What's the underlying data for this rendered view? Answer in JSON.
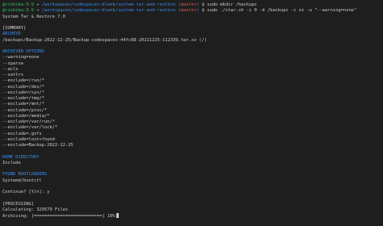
{
  "prompts": [
    {
      "user": "@rishika-3-V",
      "arrow": "→",
      "path": "/workspaces/codespaces-blank/system-tar-and-restore",
      "branch_open": "(",
      "branch": "master",
      "branch_close": ")",
      "command": "$ sudo mkdir /backups"
    },
    {
      "user": "@rishika-3-V",
      "arrow": "→",
      "path": "/workspaces/codespaces-blank/system-tar-and-restore",
      "branch_open": "(",
      "branch": "master",
      "branch_close": ")",
      "command": "$ sudo ./star.sh -i 0 -d /backups -c xz -u \"--warning=none\""
    }
  ],
  "app_title": "System Tar & Restore 7.0",
  "summary_header": "[SUMMARY]",
  "archive": {
    "label": "ARCHIVE",
    "value": "/backups/Backup-2022-12-25/Backup-codespaces-44fc88-20221225-112339.tar.xz (/)"
  },
  "archiver_options": {
    "label": "ARCHIVER OPTIONS",
    "items": [
      "--warning=none",
      "--sparse",
      "--acls",
      "--xattrs",
      "--exclude=/run/*",
      "--exclude=/dev/*",
      "--exclude=/sys/*",
      "--exclude=/tmp/*",
      "--exclude=/mnt/*",
      "--exclude=/proc/*",
      "--exclude=/media/*",
      "--exclude=/var/run/*",
      "--exclude=/var/lock/*",
      "--exclude=.gvfs",
      "--exclude=lost+found",
      "--exclude=Backup-2022-12-25"
    ]
  },
  "home_directory": {
    "label": "HOME DIRECTORY",
    "value": "Include"
  },
  "bootloaders": {
    "label": "FOUND BOOTLOADERS",
    "value": "Systemd/bootctl"
  },
  "continue_prompt": "Continue? [Y/n]: y",
  "processing": {
    "header": "[PROCESSING]",
    "calculating": "Calculating: 329579 Files",
    "archiving": "Archiving: [==========================] 10%"
  },
  "colors": {
    "background": "#1e1e1e",
    "text": "#cccccc",
    "user_green": "#35c86f",
    "path_blue": "#3b8eea",
    "branch_red": "#e5534b"
  }
}
